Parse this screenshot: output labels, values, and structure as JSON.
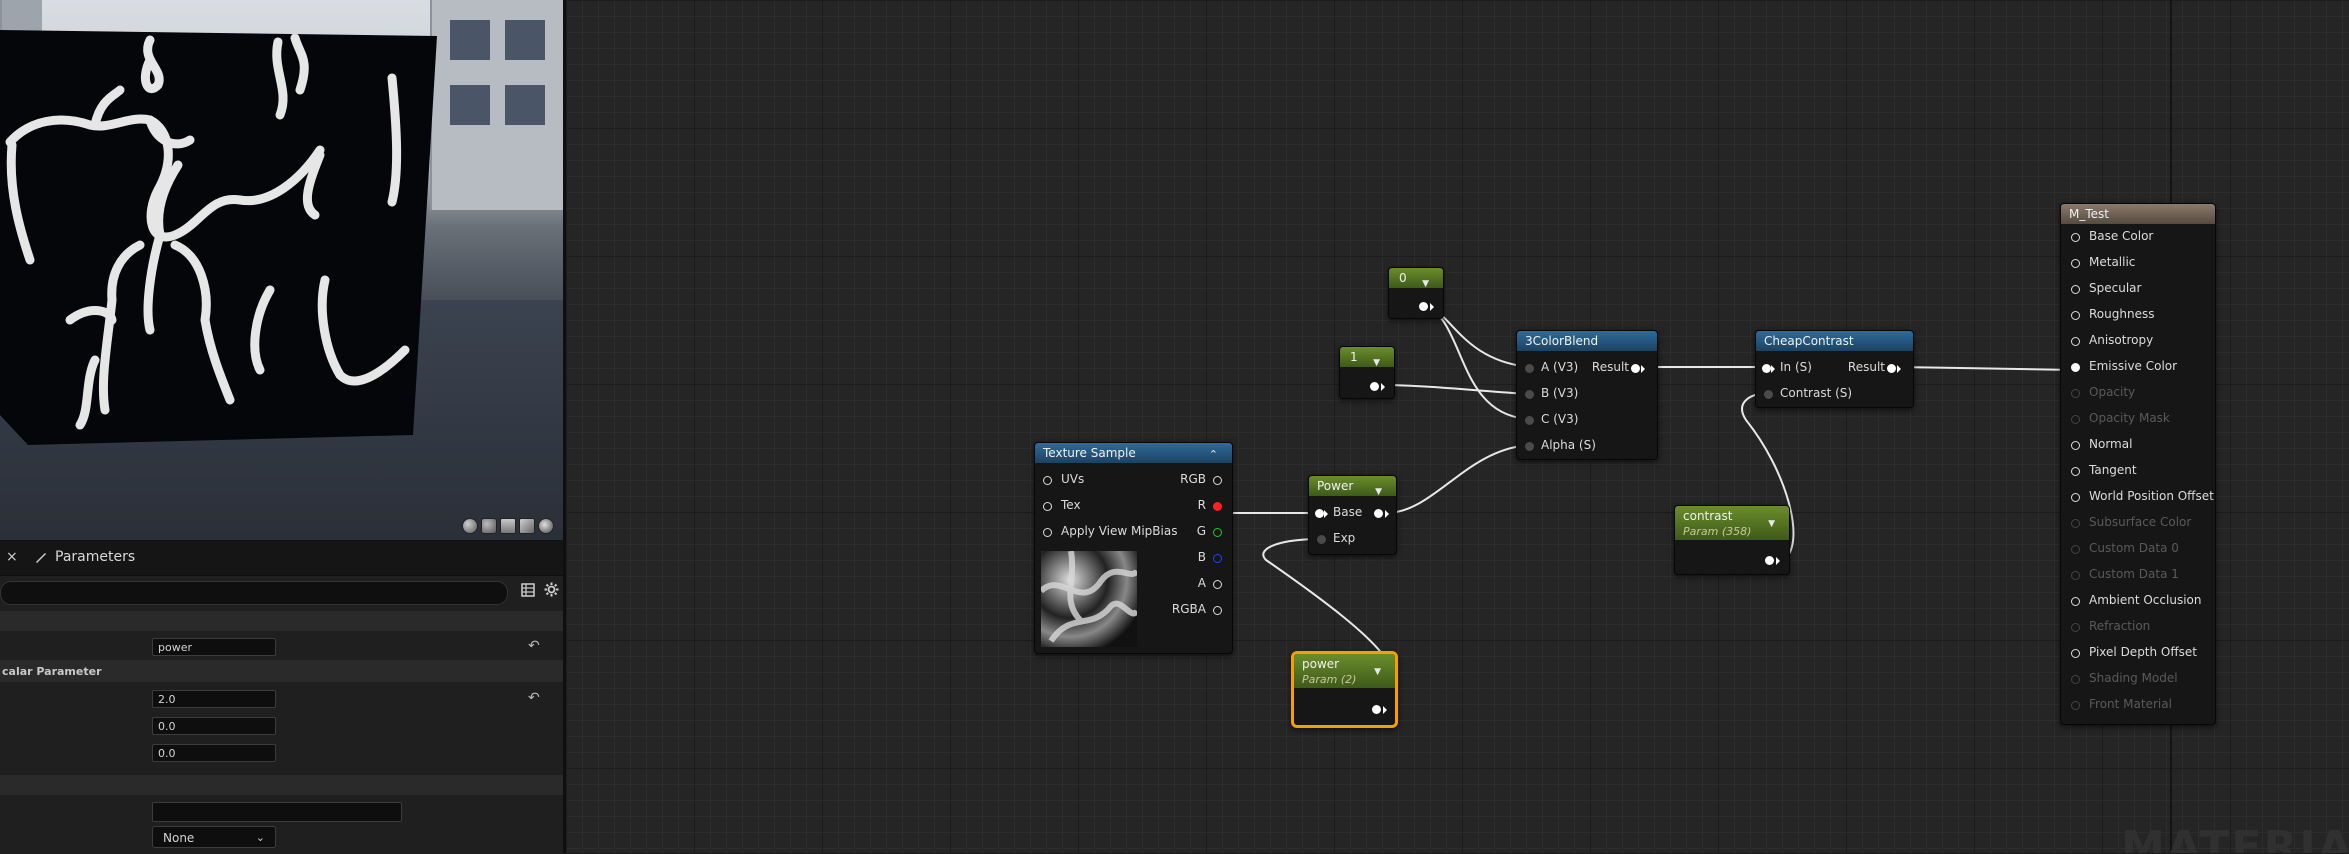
{
  "viewport": {
    "preview_shapes": [
      "sphere",
      "cylinder",
      "plane",
      "cube",
      "custom"
    ]
  },
  "params_panel": {
    "tab_label": "Parameters",
    "close_glyph": "×",
    "search_placeholder": "",
    "rows": [
      {
        "kind": "field",
        "value": "power",
        "reset": true
      },
      {
        "kind": "category",
        "label": "calar Parameter"
      },
      {
        "kind": "field",
        "value": "2.0",
        "reset": true
      },
      {
        "kind": "field",
        "value": "0.0",
        "reset": false
      },
      {
        "kind": "field",
        "value": "0.0",
        "reset": false
      }
    ],
    "select_value": "None"
  },
  "graph": {
    "watermark": "MATERIAL",
    "nodes": {
      "const0": {
        "title": "0"
      },
      "const1": {
        "title": "1"
      },
      "texture": {
        "title": "Texture Sample",
        "inputs": [
          "UVs",
          "Tex",
          "Apply View MipBias"
        ],
        "outputs": [
          "RGB",
          "R",
          "G",
          "B",
          "A",
          "RGBA"
        ]
      },
      "power": {
        "title": "Power",
        "inputs": [
          "Base",
          "Exp"
        ]
      },
      "power_param": {
        "title": "power",
        "subtitle": "Param (2)"
      },
      "blend": {
        "title": "3ColorBlend",
        "inputs": [
          "A (V3)",
          "B (V3)",
          "C (V3)",
          "Alpha (S)"
        ],
        "output": "Result"
      },
      "contrast": {
        "title": "CheapContrast",
        "inputs": [
          "In (S)",
          "Contrast (S)"
        ],
        "output": "Result"
      },
      "contrast_param": {
        "title": "contrast",
        "subtitle": "Param (358)"
      },
      "material": {
        "title": "M_Test",
        "pins": [
          {
            "label": "Base Color",
            "active": true
          },
          {
            "label": "Metallic",
            "active": true
          },
          {
            "label": "Specular",
            "active": true
          },
          {
            "label": "Roughness",
            "active": true
          },
          {
            "label": "Anisotropy",
            "active": true
          },
          {
            "label": "Emissive Color",
            "active": true,
            "connected": true
          },
          {
            "label": "Opacity",
            "active": false
          },
          {
            "label": "Opacity Mask",
            "active": false
          },
          {
            "label": "Normal",
            "active": true
          },
          {
            "label": "Tangent",
            "active": true
          },
          {
            "label": "World Position Offset",
            "active": true
          },
          {
            "label": "Subsurface Color",
            "active": false
          },
          {
            "label": "Custom Data 0",
            "active": false
          },
          {
            "label": "Custom Data 1",
            "active": false
          },
          {
            "label": "Ambient Occlusion",
            "active": true
          },
          {
            "label": "Refraction",
            "active": false
          },
          {
            "label": "Pixel Depth Offset",
            "active": true
          },
          {
            "label": "Shading Model",
            "active": false
          },
          {
            "label": "Front Material",
            "active": false
          }
        ]
      }
    },
    "colors": {
      "red_pin": "#ff2020",
      "green_pin": "#22cc22",
      "blue_pin": "#2040ff",
      "selected": "#f5a000"
    }
  }
}
